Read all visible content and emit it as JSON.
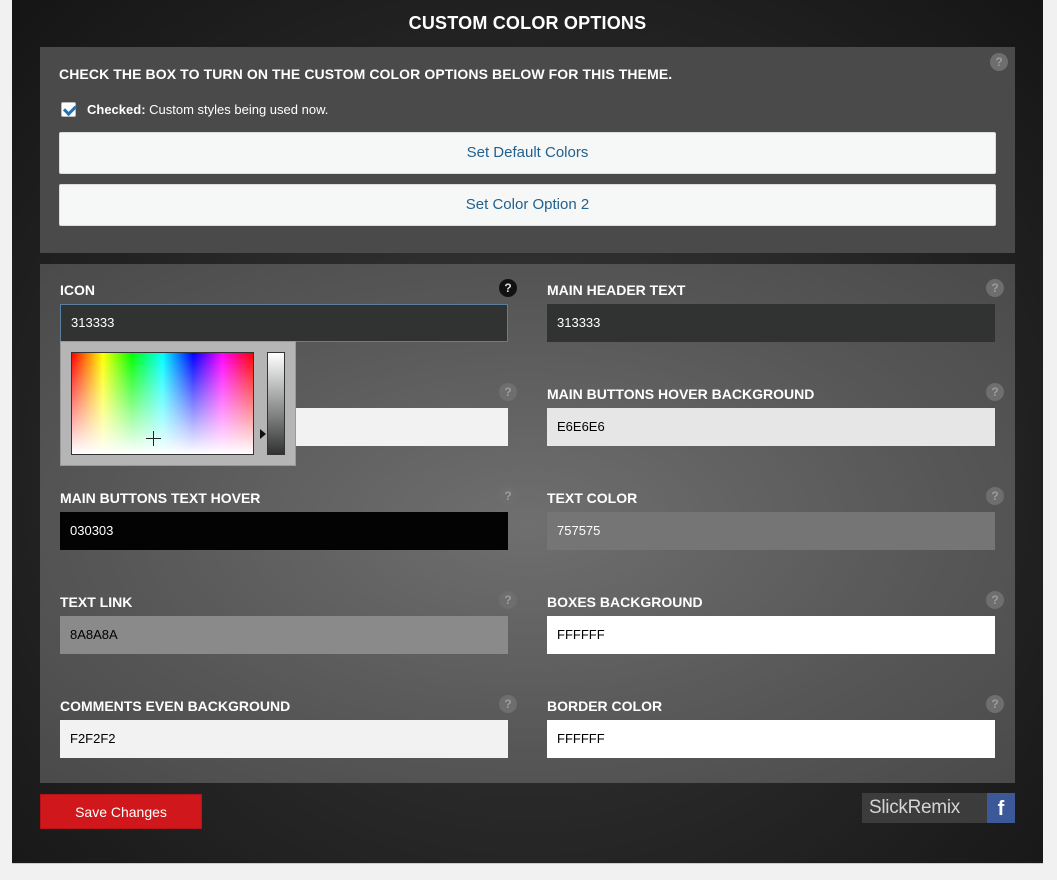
{
  "section_title": "CUSTOM COLOR OPTIONS",
  "top_panel": {
    "heading": "CHECK THE BOX TO TURN ON THE CUSTOM COLOR OPTIONS BELOW FOR THIS THEME.",
    "checkbox_strong": "Checked:",
    "checkbox_text": " Custom styles being used now.",
    "checked": true,
    "button_default": "Set Default Colors",
    "button_option2": "Set Color Option 2",
    "help": "?"
  },
  "fields": {
    "icon": {
      "label": "ICON",
      "value": "313333",
      "bg": "#313333",
      "fg": "#ffffff"
    },
    "main_header_text": {
      "label": "MAIN HEADER TEXT",
      "value": "313333",
      "bg": "#313333",
      "fg": "#ffffff"
    },
    "hidden_left": {
      "label": "",
      "value": "",
      "bg": "#f2f2f2",
      "fg": "#000000"
    },
    "main_buttons_hover_background": {
      "label": "MAIN BUTTONS HOVER BACKGROUND",
      "value": "E6E6E6",
      "bg": "#e6e6e6",
      "fg": "#000000"
    },
    "main_buttons_text_hover": {
      "label": "MAIN BUTTONS TEXT HOVER",
      "value": "030303",
      "bg": "#030303",
      "fg": "#ffffff"
    },
    "text_color": {
      "label": "TEXT COLOR",
      "value": "757575",
      "bg": "#757575",
      "fg": "#ffffff"
    },
    "text_link": {
      "label": "TEXT LINK",
      "value": "8A8A8A",
      "bg": "#8a8a8a",
      "fg": "#000000"
    },
    "boxes_background": {
      "label": "BOXES BACKGROUND",
      "value": "FFFFFF",
      "bg": "#ffffff",
      "fg": "#000000"
    },
    "comments_even_background": {
      "label": "COMMENTS EVEN BACKGROUND",
      "value": "F2F2F2",
      "bg": "#f2f2f2",
      "fg": "#000000"
    },
    "border_color": {
      "label": "BORDER COLOR",
      "value": "FFFFFF",
      "bg": "#ffffff",
      "fg": "#000000"
    }
  },
  "help": "?",
  "footer": {
    "save_label": "Save Changes",
    "brand_text": "SlickRemix",
    "facebook_glyph": "f"
  },
  "colors": {
    "accent": "#d0181c",
    "link": "#22618e",
    "facebook": "#3b5998"
  }
}
